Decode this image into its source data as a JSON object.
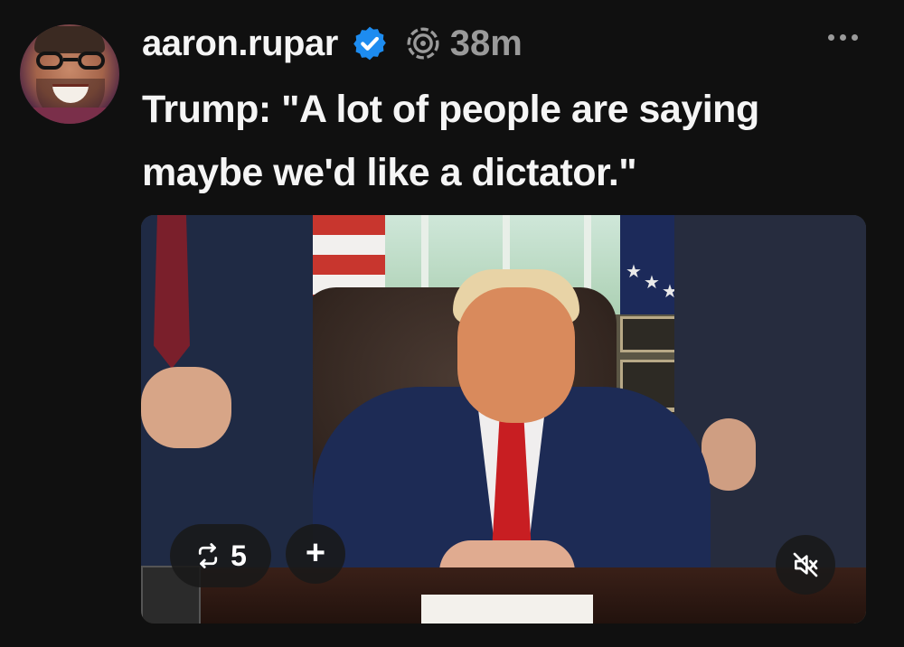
{
  "post": {
    "username": "aaron.rupar",
    "timestamp": "38m",
    "text_line1": "Trump: \"A lot of people are saying",
    "text_line2": "maybe we'd like a dictator.\""
  },
  "video": {
    "repost_count": "5"
  },
  "icons": {
    "verified": "verified-badge-icon",
    "activity": "threads-activity-icon",
    "more": "more-options-icon",
    "repost": "repost-icon",
    "add": "plus-icon",
    "mute": "muted-speaker-icon"
  },
  "colors": {
    "background": "#101010",
    "verified": "#1d8cf0",
    "muted_text": "#9a9a9a"
  }
}
